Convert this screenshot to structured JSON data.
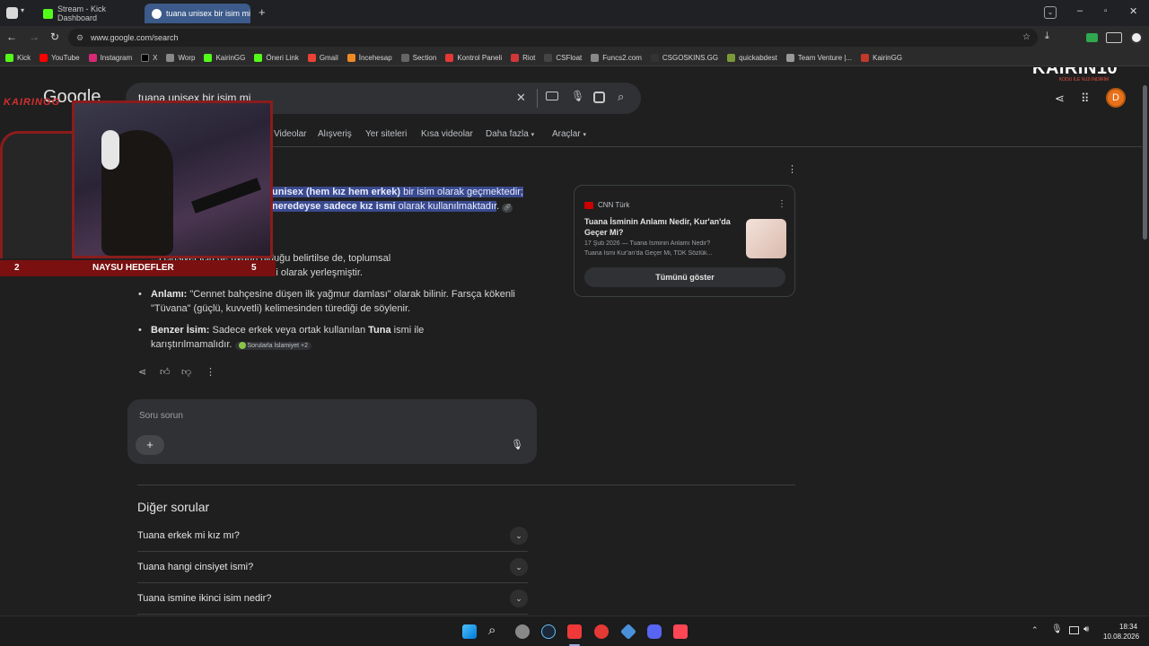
{
  "tabs": [
    {
      "label": "Stream - Kick Dashboard",
      "active": false
    },
    {
      "label": "tuana unisex bir isim mi - G",
      "active": true
    }
  ],
  "address": "www.google.com/search",
  "bookmarks": [
    "Kick",
    "YouTube",
    "Instagram",
    "X",
    "Worp",
    "KairinGG",
    "Öneri Link",
    "Gmail",
    "İncehesap",
    "Section",
    "Kontrol Paneli",
    "Riot",
    "CSFloat",
    "Funcs2.com",
    "CSGOSKINS.GG",
    "quickabdest",
    "Team Venture |...",
    "KairinGG"
  ],
  "google": {
    "logo": "Google",
    "query": "tuana unisex bir isim mi",
    "avatar_letter": "D",
    "nav_tabs": [
      "Videolar",
      "Alışveriş",
      "Yer siteleri",
      "Kısa videolar",
      "Daha fazla",
      "Araçlar"
    ]
  },
  "ai": {
    "highlight_1a": "unisex (hem kız hem erkek)",
    "highlight_1b": " bir isim olarak geçmektedir;",
    "highlight_2a": "neredeyse sadece kız ismi",
    "highlight_2b": " olarak kullanılmaktadır",
    "para_line1": "...i cinsiyet için de uygun olduğu belirtilse de, toplumsal",
    "para_line2": "kullanımda tamamen kız ismi olarak yerleşmiştir.",
    "b1_label": "Anlamı:",
    "b1_text1": " \"Cennet bahçesine düşen ilk yağmur damlası\" olarak bilinir. Farsça kökenli",
    "b1_text2": "\"Tüvana\" (güçlü, kuvvetli) kelimesinden türediği de söylenir.",
    "b2_label": "Benzer İsim:",
    "b2_text1a": " Sadece erkek veya ortak kullanılan ",
    "b2_bold": "Tuna",
    "b2_text1b": " ismi ile",
    "b2_text2": "karıştırılmamalıdır.",
    "source_chip": "Sorularla İslamiyet +2"
  },
  "source_card": {
    "publisher": "CNN Türk",
    "title": "Tuana İsminin Anlamı Nedir, Kur'an'da Geçer Mi?",
    "snippet1": "17 Şub 2026 — Tuana İsminin Anlamı Nedir?",
    "snippet2": "Tuana İsmi Kur'an'da Geçer Mi, TDK Sözlük...",
    "show_all": "Tümünü göster"
  },
  "ask_box": {
    "placeholder": "Soru sorun"
  },
  "other_questions": {
    "heading": "Diğer sorular",
    "items": [
      "Tuana erkek mi kız mı?",
      "Tuana hangi cinsiyet ismi?",
      "Tuana ismine ikinci isim nedir?"
    ]
  },
  "overlay": {
    "webcam_tag": "KAIRINGG",
    "goal_left": "2",
    "goal_label": "NAYSU HEDEFLER",
    "goal_right": "5",
    "brand": "KAIRIN10",
    "brand_sub": "KODU İLE %10 İNDİRİM"
  },
  "clock": {
    "time": "18:34",
    "date": "10.08.2026"
  },
  "colors": {
    "accent": "#8ab4f8",
    "highlight": "#3a4a8e",
    "kick_green": "#53fc18",
    "avatar": "#e8711a"
  }
}
